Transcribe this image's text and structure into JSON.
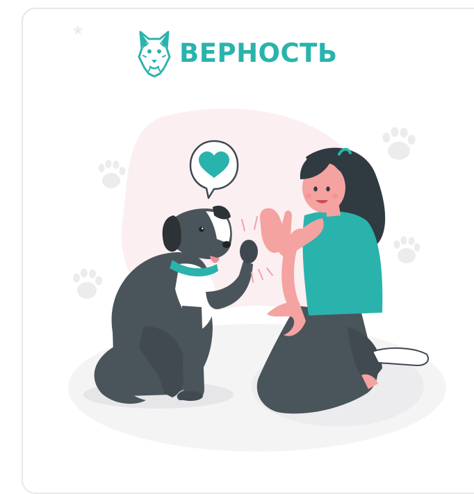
{
  "brand": {
    "name": "ВЕРНОСТЬ",
    "icon": "dog-head-icon",
    "color": "#2ab3ad"
  },
  "illustration": {
    "subject": "woman-high-five-dog",
    "icons": [
      "heart-speech-bubble-icon",
      "paw-print-icon",
      "star-icon"
    ],
    "colors": {
      "teal": "#2ab3ad",
      "dark": "#4a545b",
      "skin": "#f4a3a0",
      "blob": "#fbeff1",
      "shadow": "#ececec"
    }
  }
}
